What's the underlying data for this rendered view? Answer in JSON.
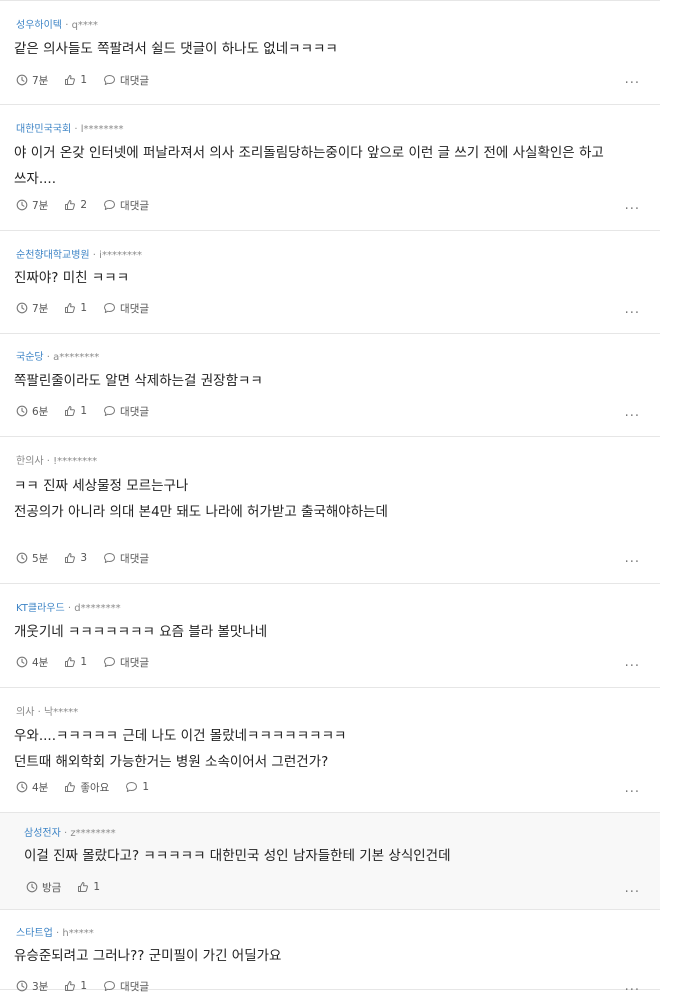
{
  "comments": [
    {
      "company": "성우하이텍",
      "user": "q****",
      "lines": [
        "같은 의사들도 쪽팔려서 쉴드 댓글이 하나도 없네ㅋㅋㅋㅋ"
      ],
      "time": "7분",
      "likes": "1",
      "reply_label": "대댓글"
    },
    {
      "company": "대한민국국회",
      "user": "l********",
      "lines": [
        "야 이거 온갖 인터넷에 퍼날라져서 의사 조리돌림당하는중이다 앞으로 이런 글 쓰기 전에 사실확인은 하고",
        "쓰자...."
      ],
      "time": "7분",
      "likes": "2",
      "reply_label": "대댓글"
    },
    {
      "company": "순천향대학교병원",
      "user": "i********",
      "lines": [
        "진짜야? 미친 ㅋㅋㅋ"
      ],
      "time": "7분",
      "likes": "1",
      "reply_label": "대댓글"
    },
    {
      "company": "국순당",
      "user": "a********",
      "lines": [
        "쪽팔린줄이라도 알면 삭제하는걸 권장함ㅋㅋ"
      ],
      "time": "6분",
      "likes": "1",
      "reply_label": "대댓글"
    },
    {
      "company": "한의사",
      "user": "!********",
      "lines": [
        "ㅋㅋ 진짜 세상물정 모르는구나",
        "",
        "전공의가 아니라 의대 본4만 돼도 나라에 허가받고 출국해야하는데"
      ],
      "time": "5분",
      "likes": "3",
      "reply_label": "대댓글"
    },
    {
      "company": "KT클라우드",
      "user": "d********",
      "lines": [
        "개웃기네 ㅋㅋㅋㅋㅋㅋㅋ 요즘 블라 볼맛나네"
      ],
      "time": "4분",
      "likes": "1",
      "reply_label": "대댓글"
    },
    {
      "company": "의사",
      "user": "낙*****",
      "lines": [
        "우와....ㅋㅋㅋㅋㅋ 근데 나도 이건 몰랐네ㅋㅋㅋㅋㅋㅋㅋㅋ",
        "던트때 해외학회 가능한거는 병원 소속이어서 그런건가?"
      ],
      "time": "4분",
      "likes": "좋아요",
      "reply_label": "1"
    },
    {
      "company": "삼성전자",
      "user": "z********",
      "lines": [
        "이걸 진짜 몰랐다고? ㅋㅋㅋㅋㅋ 대한민국 성인 남자들한테 기본 상식인건데"
      ],
      "time": "방금",
      "likes": "1",
      "reply_label": ""
    },
    {
      "company": "스타트업",
      "user": "h*****",
      "lines": [
        "유승준되려고 그러나?? 군미필이 가긴 어딜가요"
      ],
      "time": "3분",
      "likes": "1",
      "reply_label": "대댓글"
    }
  ],
  "more_label": "...",
  "separator": "·",
  "colors": {
    "company": "#3d84c6",
    "gray_company": "#888888",
    "divider": "#e6e6e6",
    "reply_bg": "#f8f8f8"
  },
  "icons": {
    "time": "clock-icon",
    "like": "thumbs-up-icon",
    "reply": "speech-bubble-icon",
    "more": "more-dots-icon"
  }
}
